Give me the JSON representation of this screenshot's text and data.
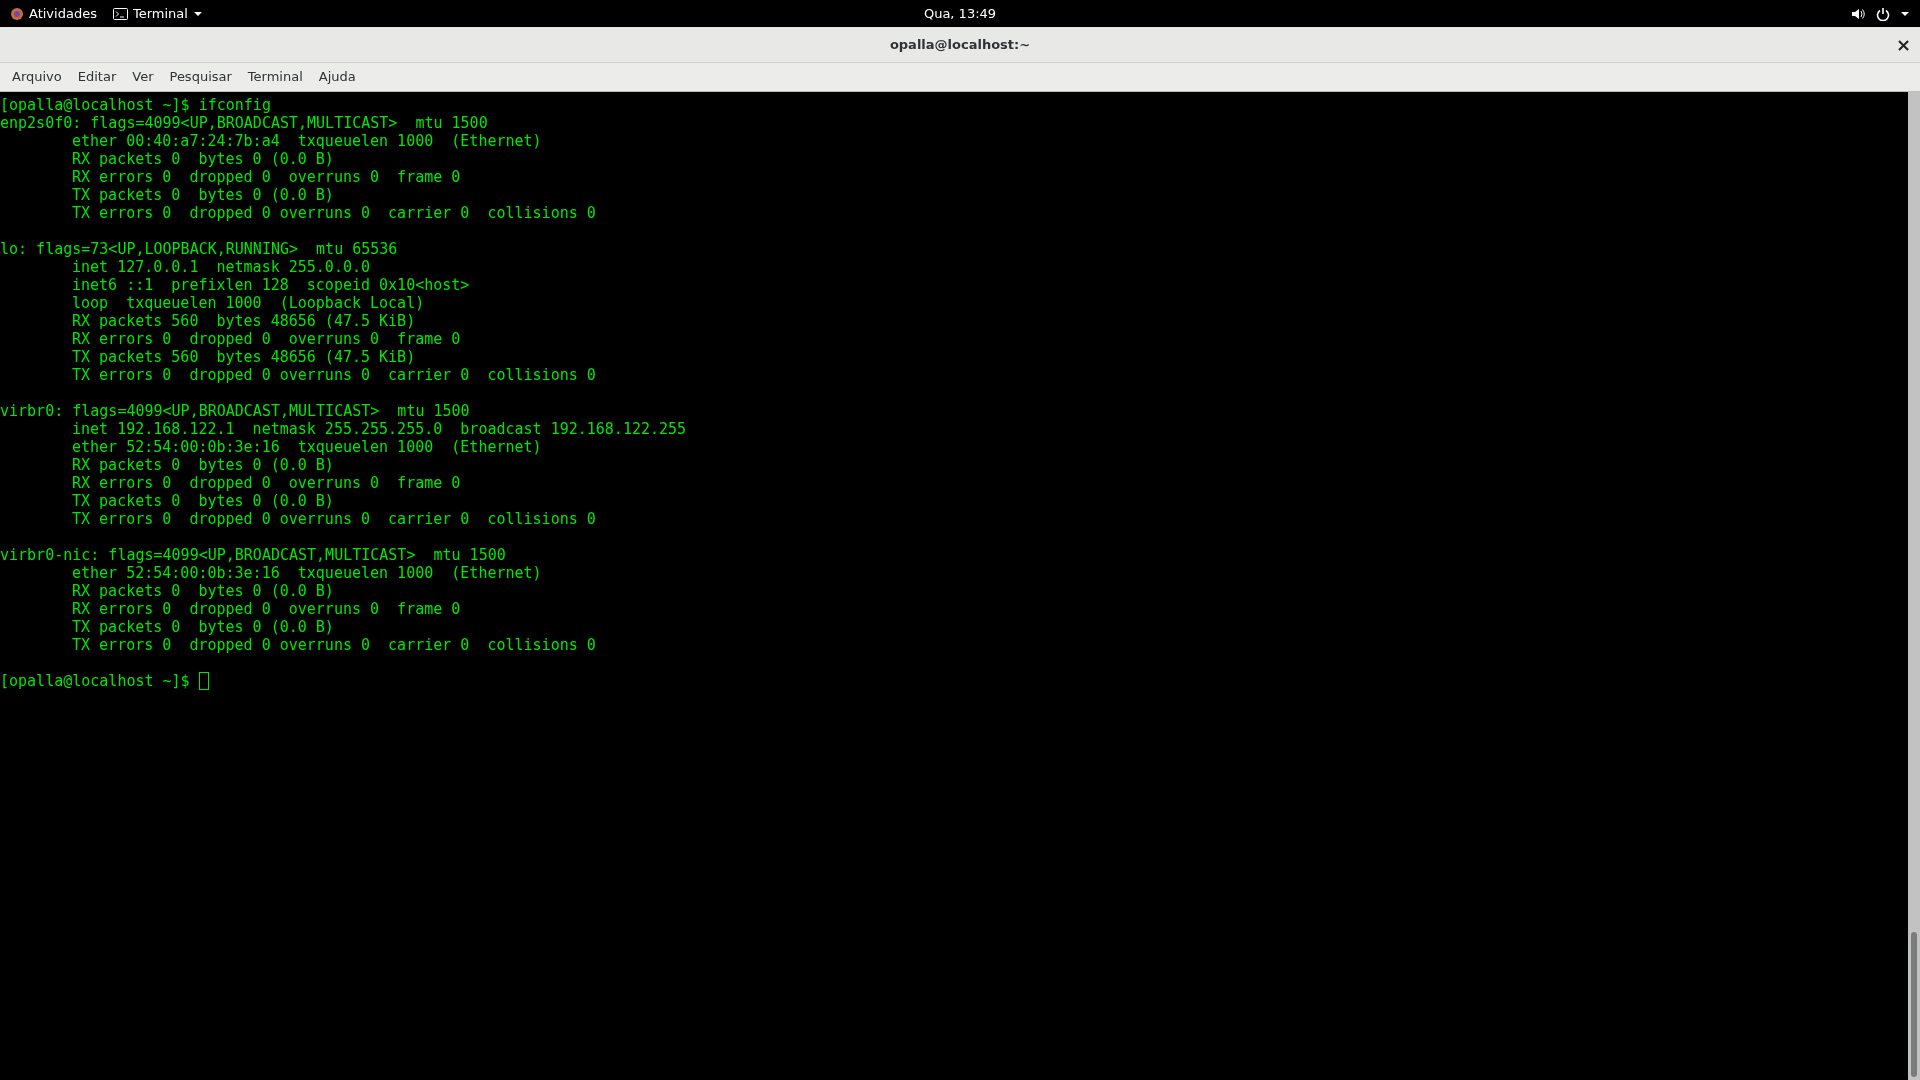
{
  "top_bar": {
    "activities": "Atividades",
    "app_menu": "Terminal",
    "clock": "Qua, 13:49"
  },
  "window": {
    "title": "opalla@localhost:~",
    "close": "×"
  },
  "menu_bar": [
    "Arquivo",
    "Editar",
    "Ver",
    "Pesquisar",
    "Terminal",
    "Ajuda"
  ],
  "terminal": {
    "entries": [
      {
        "kind": "command",
        "text": "[opalla@localhost ~]$ ifconfig"
      },
      {
        "kind": "output",
        "header": "enp2s0f0: flags=4099<UP,BROADCAST,MULTICAST>  mtu 1500",
        "details": [
          "ether 00:40:a7:24:7b:a4  txqueuelen 1000  (Ethernet)",
          "RX packets 0  bytes 0 (0.0 B)",
          "RX errors 0  dropped 0  overruns 0  frame 0",
          "TX packets 0  bytes 0 (0.0 B)",
          "TX errors 0  dropped 0 overruns 0  carrier 0  collisions 0"
        ]
      },
      {
        "kind": "output",
        "header": "lo: flags=73<UP,LOOPBACK,RUNNING>  mtu 65536",
        "details": [
          "inet 127.0.0.1  netmask 255.0.0.0",
          "inet6 ::1  prefixlen 128  scopeid 0x10<host>",
          "loop  txqueuelen 1000  (Loopback Local)",
          "RX packets 560  bytes 48656 (47.5 KiB)",
          "RX errors 0  dropped 0  overruns 0  frame 0",
          "TX packets 560  bytes 48656 (47.5 KiB)",
          "TX errors 0  dropped 0 overruns 0  carrier 0  collisions 0"
        ]
      },
      {
        "kind": "output",
        "header": "virbr0: flags=4099<UP,BROADCAST,MULTICAST>  mtu 1500",
        "details": [
          "inet 192.168.122.1  netmask 255.255.255.0  broadcast 192.168.122.255",
          "ether 52:54:00:0b:3e:16  txqueuelen 1000  (Ethernet)",
          "RX packets 0  bytes 0 (0.0 B)",
          "RX errors 0  dropped 0  overruns 0  frame 0",
          "TX packets 0  bytes 0 (0.0 B)",
          "TX errors 0  dropped 0 overruns 0  carrier 0  collisions 0"
        ]
      },
      {
        "kind": "output",
        "header": "virbr0-nic: flags=4099<UP,BROADCAST,MULTICAST>  mtu 1500",
        "details": [
          "ether 52:54:00:0b:3e:16  txqueuelen 1000  (Ethernet)",
          "RX packets 0  bytes 0 (0.0 B)",
          "RX errors 0  dropped 0  overruns 0  frame 0",
          "TX packets 0  bytes 0 (0.0 B)",
          "TX errors 0  dropped 0 overruns 0  carrier 0  collisions 0"
        ]
      },
      {
        "kind": "prompt",
        "text": "[opalla@localhost ~]$",
        "cursor": true
      }
    ]
  }
}
